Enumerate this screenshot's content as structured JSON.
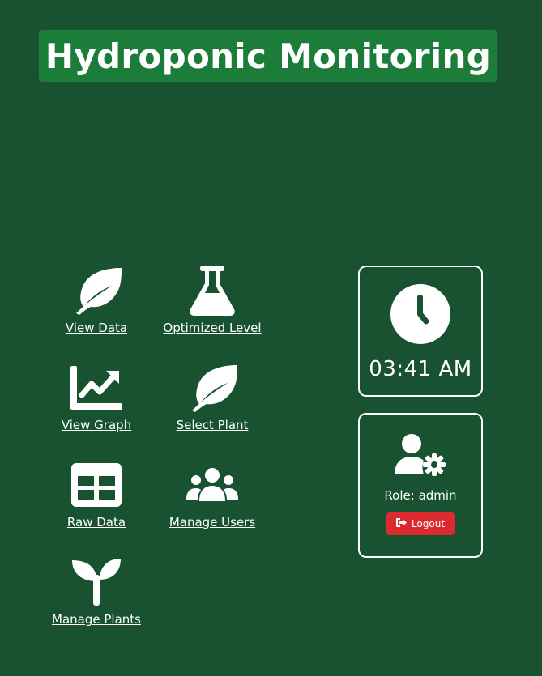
{
  "header": {
    "title": "Hydroponic Monitoring"
  },
  "nav": {
    "view_data": {
      "label": "View Data",
      "icon": "leaf-icon"
    },
    "optimized_level": {
      "label": "Optimized Level",
      "icon": "flask-icon"
    },
    "view_graph": {
      "label": "View Graph",
      "icon": "chart-line-icon"
    },
    "select_plant": {
      "label": "Select Plant",
      "icon": "leaf-icon"
    },
    "raw_data": {
      "label": "Raw Data",
      "icon": "table-icon"
    },
    "manage_users": {
      "label": "Manage Users",
      "icon": "users-icon"
    },
    "manage_plants": {
      "label": "Manage Plants",
      "icon": "seedling-icon"
    }
  },
  "clock": {
    "time": "03:41 AM",
    "icon": "clock-icon"
  },
  "user": {
    "role_text": "Role: admin",
    "icon": "user-gear-icon",
    "logout_label": "Logout",
    "logout_icon": "sign-out-icon"
  },
  "colors": {
    "background": "#185230",
    "banner": "#1c7d3b",
    "logout": "#dc2a2f",
    "text": "#ffffff"
  }
}
